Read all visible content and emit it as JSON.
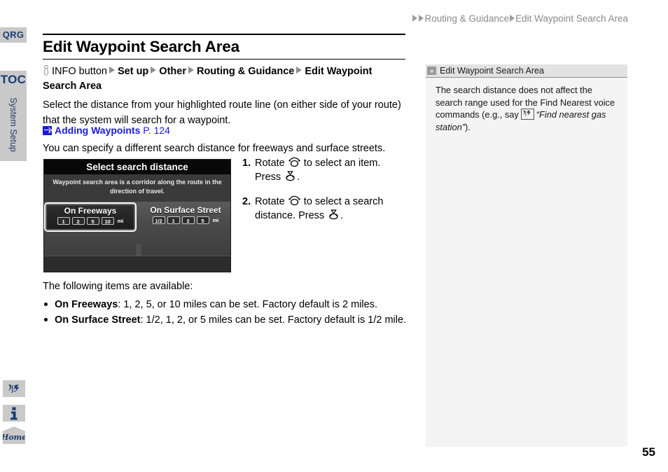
{
  "breadcrumb": {
    "items": [
      "Routing & Guidance",
      "Edit Waypoint Search Area"
    ]
  },
  "page": {
    "title": "Edit Waypoint Search Area",
    "number": "55"
  },
  "left_rail": {
    "qrg_label": "QRG",
    "toc_label": "TOC",
    "section_label": "System Setup",
    "home_label": "Home",
    "voice_icon": "voice-command-icon",
    "info_icon": "info-icon",
    "home_icon": "home-icon"
  },
  "nav_path": {
    "info_button_icon": "info-button-press-icon",
    "info_button_label": "INFO button",
    "segments": [
      "Set up",
      "Other",
      "Routing & Guidance",
      "Edit Waypoint Search Area"
    ]
  },
  "body": {
    "intro": "Select the distance from your highlighted route line (on either side of your route) that the system will search for a waypoint.",
    "reference_link": "Adding Waypoints",
    "reference_page": "P. 124",
    "second_para": "You can specify a different search distance for freeways and surface streets.",
    "available_intro": "The following items are available:",
    "available_items": [
      {
        "term": "On Freeways",
        "desc": ": 1, 2, 5, or 10 miles can be set. Factory default is 2 miles."
      },
      {
        "term": "On Surface Street",
        "desc": ": 1/2, 1, 2, or 5 miles can be set. Factory default is 1/2 mile."
      }
    ]
  },
  "nav_screen": {
    "title": "Select search distance",
    "description": "Waypoint search area is a corridor along the route in the direction of travel.",
    "freeways": {
      "label": "On Freeways",
      "options": [
        "1",
        "2",
        "5",
        "10"
      ],
      "unit": "mi"
    },
    "surface": {
      "label": "On Surface Street",
      "options": [
        "1/2",
        "1",
        "2",
        "5"
      ],
      "unit": "mi"
    }
  },
  "steps": [
    {
      "num": "1.",
      "text_a": "Rotate",
      "text_b": "to select an item. Press",
      "text_c": ".",
      "rotate_icon": "rotate-knob-icon",
      "press_icon": "press-knob-icon"
    },
    {
      "num": "2.",
      "text_a": "Rotate",
      "text_b": "to select a search distance. Press",
      "text_c": ".",
      "rotate_icon": "rotate-knob-icon",
      "press_icon": "press-knob-icon"
    }
  ],
  "side_note": {
    "chevron_icon": "double-chevron-icon",
    "header": "Edit Waypoint Search Area",
    "text_a": "The search distance does not affect the search range used for the Find Nearest voice commands (e.g., say",
    "voice_icon": "voice-command-icon",
    "quote": "“Find nearest gas station”",
    "text_b": ")."
  }
}
